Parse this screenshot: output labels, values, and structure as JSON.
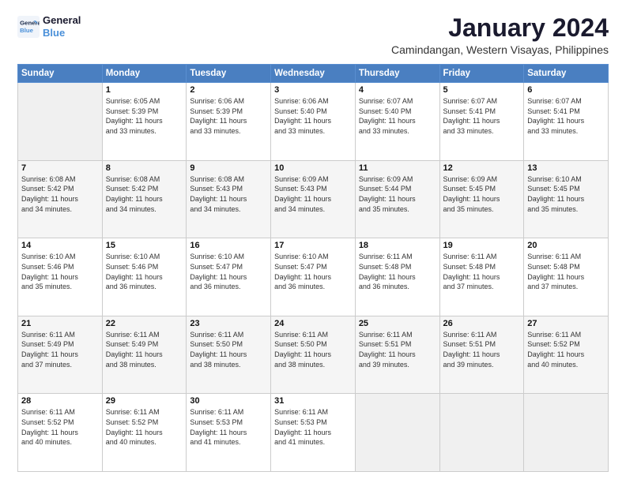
{
  "logo": {
    "line1": "General",
    "line2": "Blue"
  },
  "title": "January 2024",
  "subtitle": "Camindangan, Western Visayas, Philippines",
  "days_header": [
    "Sunday",
    "Monday",
    "Tuesday",
    "Wednesday",
    "Thursday",
    "Friday",
    "Saturday"
  ],
  "weeks": [
    [
      {
        "day": "",
        "info": ""
      },
      {
        "day": "1",
        "info": "Sunrise: 6:05 AM\nSunset: 5:39 PM\nDaylight: 11 hours\nand 33 minutes."
      },
      {
        "day": "2",
        "info": "Sunrise: 6:06 AM\nSunset: 5:39 PM\nDaylight: 11 hours\nand 33 minutes."
      },
      {
        "day": "3",
        "info": "Sunrise: 6:06 AM\nSunset: 5:40 PM\nDaylight: 11 hours\nand 33 minutes."
      },
      {
        "day": "4",
        "info": "Sunrise: 6:07 AM\nSunset: 5:40 PM\nDaylight: 11 hours\nand 33 minutes."
      },
      {
        "day": "5",
        "info": "Sunrise: 6:07 AM\nSunset: 5:41 PM\nDaylight: 11 hours\nand 33 minutes."
      },
      {
        "day": "6",
        "info": "Sunrise: 6:07 AM\nSunset: 5:41 PM\nDaylight: 11 hours\nand 33 minutes."
      }
    ],
    [
      {
        "day": "7",
        "info": "Sunrise: 6:08 AM\nSunset: 5:42 PM\nDaylight: 11 hours\nand 34 minutes."
      },
      {
        "day": "8",
        "info": "Sunrise: 6:08 AM\nSunset: 5:42 PM\nDaylight: 11 hours\nand 34 minutes."
      },
      {
        "day": "9",
        "info": "Sunrise: 6:08 AM\nSunset: 5:43 PM\nDaylight: 11 hours\nand 34 minutes."
      },
      {
        "day": "10",
        "info": "Sunrise: 6:09 AM\nSunset: 5:43 PM\nDaylight: 11 hours\nand 34 minutes."
      },
      {
        "day": "11",
        "info": "Sunrise: 6:09 AM\nSunset: 5:44 PM\nDaylight: 11 hours\nand 35 minutes."
      },
      {
        "day": "12",
        "info": "Sunrise: 6:09 AM\nSunset: 5:45 PM\nDaylight: 11 hours\nand 35 minutes."
      },
      {
        "day": "13",
        "info": "Sunrise: 6:10 AM\nSunset: 5:45 PM\nDaylight: 11 hours\nand 35 minutes."
      }
    ],
    [
      {
        "day": "14",
        "info": "Sunrise: 6:10 AM\nSunset: 5:46 PM\nDaylight: 11 hours\nand 35 minutes."
      },
      {
        "day": "15",
        "info": "Sunrise: 6:10 AM\nSunset: 5:46 PM\nDaylight: 11 hours\nand 36 minutes."
      },
      {
        "day": "16",
        "info": "Sunrise: 6:10 AM\nSunset: 5:47 PM\nDaylight: 11 hours\nand 36 minutes."
      },
      {
        "day": "17",
        "info": "Sunrise: 6:10 AM\nSunset: 5:47 PM\nDaylight: 11 hours\nand 36 minutes."
      },
      {
        "day": "18",
        "info": "Sunrise: 6:11 AM\nSunset: 5:48 PM\nDaylight: 11 hours\nand 36 minutes."
      },
      {
        "day": "19",
        "info": "Sunrise: 6:11 AM\nSunset: 5:48 PM\nDaylight: 11 hours\nand 37 minutes."
      },
      {
        "day": "20",
        "info": "Sunrise: 6:11 AM\nSunset: 5:48 PM\nDaylight: 11 hours\nand 37 minutes."
      }
    ],
    [
      {
        "day": "21",
        "info": "Sunrise: 6:11 AM\nSunset: 5:49 PM\nDaylight: 11 hours\nand 37 minutes."
      },
      {
        "day": "22",
        "info": "Sunrise: 6:11 AM\nSunset: 5:49 PM\nDaylight: 11 hours\nand 38 minutes."
      },
      {
        "day": "23",
        "info": "Sunrise: 6:11 AM\nSunset: 5:50 PM\nDaylight: 11 hours\nand 38 minutes."
      },
      {
        "day": "24",
        "info": "Sunrise: 6:11 AM\nSunset: 5:50 PM\nDaylight: 11 hours\nand 38 minutes."
      },
      {
        "day": "25",
        "info": "Sunrise: 6:11 AM\nSunset: 5:51 PM\nDaylight: 11 hours\nand 39 minutes."
      },
      {
        "day": "26",
        "info": "Sunrise: 6:11 AM\nSunset: 5:51 PM\nDaylight: 11 hours\nand 39 minutes."
      },
      {
        "day": "27",
        "info": "Sunrise: 6:11 AM\nSunset: 5:52 PM\nDaylight: 11 hours\nand 40 minutes."
      }
    ],
    [
      {
        "day": "28",
        "info": "Sunrise: 6:11 AM\nSunset: 5:52 PM\nDaylight: 11 hours\nand 40 minutes."
      },
      {
        "day": "29",
        "info": "Sunrise: 6:11 AM\nSunset: 5:52 PM\nDaylight: 11 hours\nand 40 minutes."
      },
      {
        "day": "30",
        "info": "Sunrise: 6:11 AM\nSunset: 5:53 PM\nDaylight: 11 hours\nand 41 minutes."
      },
      {
        "day": "31",
        "info": "Sunrise: 6:11 AM\nSunset: 5:53 PM\nDaylight: 11 hours\nand 41 minutes."
      },
      {
        "day": "",
        "info": ""
      },
      {
        "day": "",
        "info": ""
      },
      {
        "day": "",
        "info": ""
      }
    ]
  ]
}
